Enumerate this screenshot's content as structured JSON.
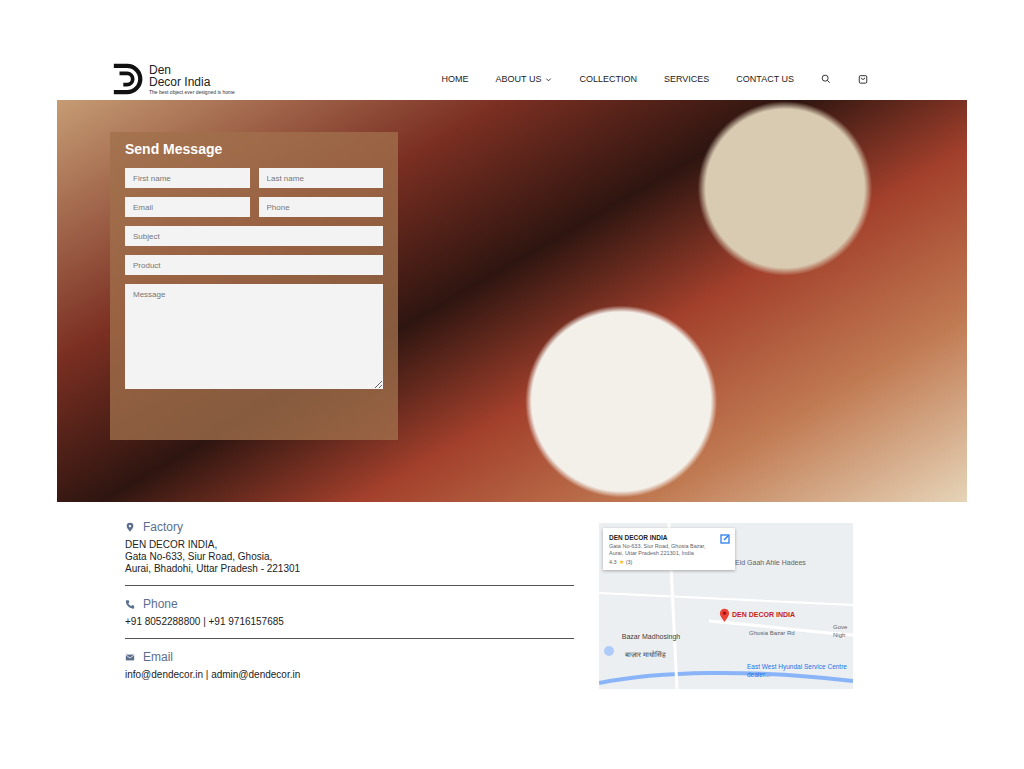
{
  "header": {
    "logo": {
      "line1": "Den",
      "line2": "Decor India",
      "tagline": "The best object ever designed is home"
    },
    "nav": [
      {
        "label": "HOME",
        "dropdown": false
      },
      {
        "label": "ABOUT US",
        "dropdown": true
      },
      {
        "label": "COLLECTION",
        "dropdown": false
      },
      {
        "label": "SERVICES",
        "dropdown": false
      },
      {
        "label": "CONTACT US",
        "dropdown": false
      }
    ]
  },
  "form": {
    "title": "Send Message",
    "rows": [
      [
        {
          "placeholder": "First name",
          "kind": "input"
        },
        {
          "placeholder": "Last name",
          "kind": "input"
        }
      ],
      [
        {
          "placeholder": "Email",
          "kind": "input"
        },
        {
          "placeholder": "Phone",
          "kind": "input"
        }
      ],
      [
        {
          "placeholder": "Subject",
          "kind": "input"
        }
      ],
      [
        {
          "placeholder": "Product",
          "kind": "input"
        }
      ],
      [
        {
          "placeholder": "Message",
          "kind": "textarea"
        }
      ]
    ]
  },
  "contact": [
    {
      "kind": "factory",
      "title": "Factory",
      "lines": [
        "DEN DECOR INDIA,",
        "Gata No-633, Siur Road, Ghosia,",
        "Aurai, Bhadohi, Uttar Pradesh - 221301"
      ]
    },
    {
      "kind": "phone",
      "title": "Phone",
      "lines": [
        "+91 8052288800 | +91 9716157685"
      ]
    },
    {
      "kind": "email",
      "title": "Email",
      "lines": [
        "info@dendecor.in | admin@dendecor.in"
      ]
    }
  ],
  "map": {
    "card": {
      "title": "DEN DECOR INDIA",
      "address": "Gata No-633, Siur Road, Ghosia Bazar, Aurai, Uttar Pradesh 221301, India",
      "rating": "4.3",
      "star": "★",
      "count": "(3)"
    },
    "labels": [
      {
        "text": "Eid Gaah Ahle Hadees",
        "color": "#5f6368"
      },
      {
        "text": "DEN DECOR INDIA",
        "color": "#c5221f"
      },
      {
        "text": "Ghosia Bazar Rd",
        "color": "#5f6368"
      },
      {
        "text": "Bazar Madhosingh",
        "color": "#3c4043"
      },
      {
        "text": "बाज़ार माधोसिंह",
        "color": "#3c4043"
      },
      {
        "text": "East West Hyundai Service Centre dealer...",
        "color": "#1a73e8"
      },
      {
        "text": "Gove Nigh",
        "color": "#5f6368"
      }
    ]
  }
}
